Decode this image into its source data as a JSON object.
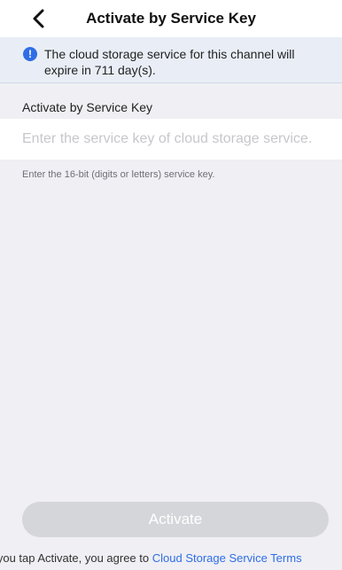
{
  "header": {
    "title": "Activate by Service Key",
    "back_icon": "chevron-left-icon"
  },
  "banner": {
    "icon": "exclamation-icon",
    "icon_glyph": "!",
    "message": "The cloud storage service for this channel will expire in 711 day(s).",
    "accent_color": "#2f6ee6"
  },
  "form": {
    "section_label": "Activate by Service Key",
    "key_placeholder": "Enter the service key of cloud storage service.",
    "key_value": "",
    "hint": "Enter the 16-bit (digits or letters) service key."
  },
  "footer": {
    "activate_label": "Activate",
    "activate_enabled": false,
    "terms_prefix": "If you tap Activate, you agree to ",
    "terms_link": "Cloud Storage Service Terms"
  }
}
